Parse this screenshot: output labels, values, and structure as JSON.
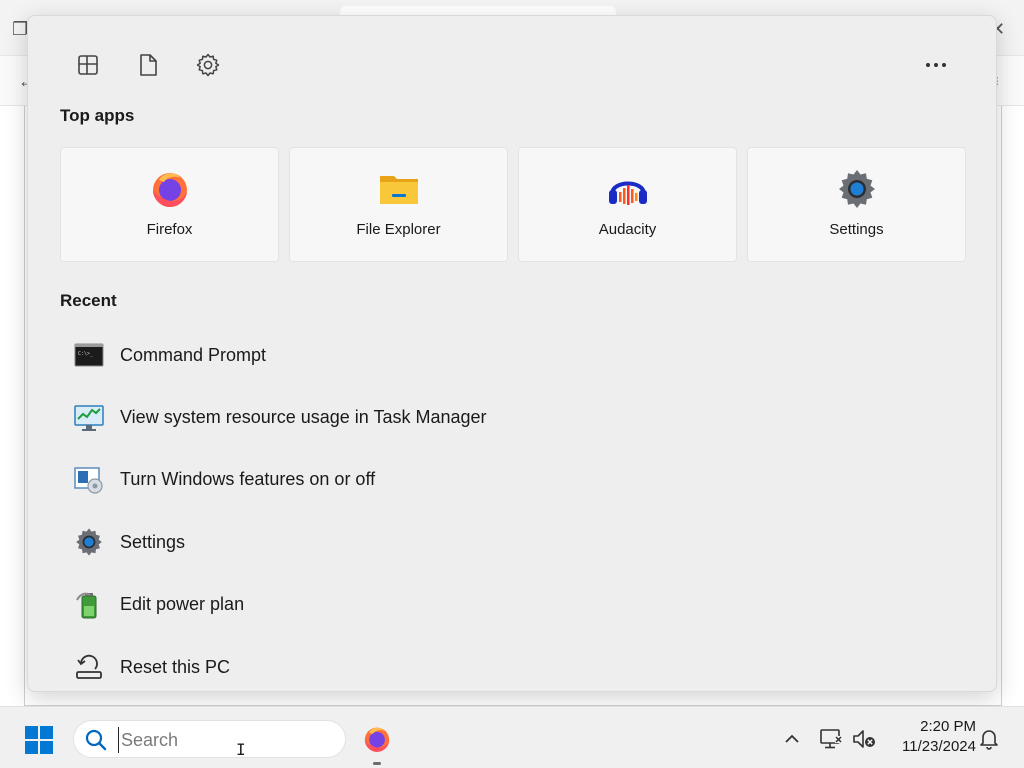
{
  "menu": {
    "top_buttons": [
      {
        "icon": "widgets-icon"
      },
      {
        "icon": "document-icon"
      },
      {
        "icon": "settings-gear-icon"
      }
    ],
    "more_icon": "more-dots-icon",
    "top_apps_title": "Top apps",
    "top_apps": [
      {
        "label": "Firefox",
        "icon": "firefox-icon"
      },
      {
        "label": "File Explorer",
        "icon": "file-explorer-icon"
      },
      {
        "label": "Audacity",
        "icon": "audacity-icon"
      },
      {
        "label": "Settings",
        "icon": "settings-icon"
      }
    ],
    "recent_title": "Recent",
    "recent": [
      {
        "label": "Command Prompt",
        "icon": "command-prompt-icon"
      },
      {
        "label": "View system resource usage in Task Manager",
        "icon": "task-manager-icon"
      },
      {
        "label": "Turn Windows features on or off",
        "icon": "windows-features-icon"
      },
      {
        "label": "Settings",
        "icon": "settings-icon"
      },
      {
        "label": "Edit power plan",
        "icon": "power-plan-icon"
      },
      {
        "label": "Reset this PC",
        "icon": "reset-pc-icon"
      }
    ]
  },
  "taskbar": {
    "search_placeholder": "Search",
    "time": "2:20 PM",
    "date": "11/23/2024"
  },
  "colors": {
    "windows_blue": "#0078d4",
    "firefox_orange": "#ff7139",
    "firefox_purple": "#7542e5",
    "folder_yellow": "#f8c73a",
    "menu_background": "#eeeeee"
  }
}
